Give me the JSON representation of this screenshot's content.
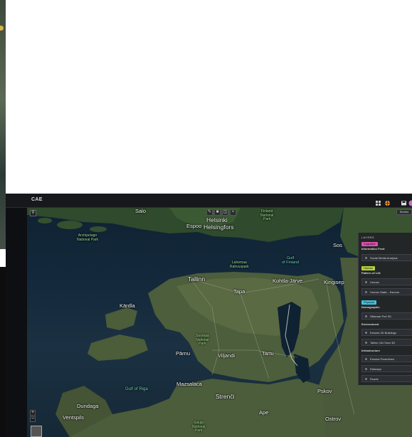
{
  "app": {
    "title": "CAE"
  },
  "topbar": {
    "icons": [
      "grid-icon",
      "globe-icon",
      "save-icon",
      "user-avatar-icon"
    ]
  },
  "map_controls": {
    "search_icon": "search-icon",
    "toolbar_icons": [
      "draw-icon",
      "measure-icon",
      "layers-toggle-icon",
      "close-icon"
    ],
    "stories_label": "Stories",
    "zoom_in": "+",
    "zoom_out": "−"
  },
  "map": {
    "labels": {
      "salo": "Salo",
      "espoo": "Espoo",
      "helsinki": "Helsinki",
      "helsingfors": "Helsingfors",
      "finland_park": "Finland\nNational\nPark",
      "archipelago": "Archipelago\nNational Park",
      "lahemaa": "Lahemaa\nRahvuspark",
      "gulf_finland": "Gulf\nof Finland",
      "sos": "Sos",
      "tallinn": "Tallinn",
      "tapa": "Tapa",
      "kohtla": "Kohtla-Järve",
      "kingisepp": "Kingisep",
      "kardla": "Kärdla",
      "soomaa": "Soomaa\nNational\nPark",
      "parnu": "Pärnu",
      "viljandi": "Viljandi",
      "tartu": "Tartu",
      "gulf_riga": "Gulf of Riga",
      "mazsalaca": "Mazsalaca",
      "strenci": "Strenči",
      "pskov": "Pskov",
      "dundaga": "Dundaga",
      "ventspils": "Ventspils",
      "ape": "Ape",
      "ostrov": "Ostrov",
      "gauja": "Gauja\nNational\nPark"
    }
  },
  "layers_panel": {
    "title": "LAYERS",
    "header_icons": [
      "eye-icon",
      "settings-icon"
    ],
    "categories": [
      {
        "tag": "Cognitive",
        "tag_color": "#e04fb0",
        "subtitle": "Information Feed",
        "items": [
          "Social Media Analysis"
        ]
      },
      {
        "tag": "Human",
        "tag_color": "#b9d23c",
        "subtitle": "Pattern of Life",
        "items": [
          "Human",
          "Human Static - Estonia"
        ]
      },
      {
        "tag": "Physical",
        "tag_color": "#3fc3e0",
        "subtitle": "Demographic",
        "items": [
          "Sillamae Port 3D"
        ]
      },
      {
        "tag": "",
        "tag_color": "",
        "subtitle": "Environment",
        "items": [
          "Estonia 3D Buildings",
          "Tallinn Old Town 3D"
        ]
      },
      {
        "tag": "",
        "tag_color": "",
        "subtitle": "Infrastructure",
        "items": [
          "Estonia Powerlines",
          "Railways",
          "Roads"
        ]
      }
    ]
  }
}
